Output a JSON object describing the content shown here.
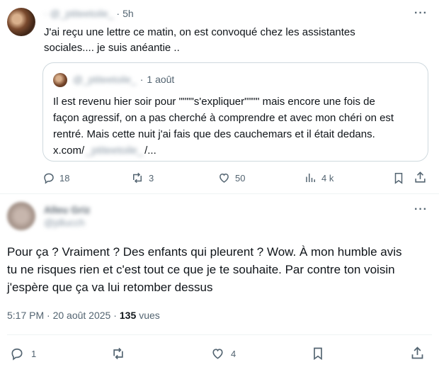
{
  "parent_post": {
    "display_name": "·",
    "handle": "@_ptiteetoile_",
    "separator": "·",
    "time": "5h",
    "text_line1": "J'ai reçu une lettre ce matin, on est convoqué chez les assistantes",
    "text_line2": "sociales.... je suis anéantie ..",
    "quoted": {
      "handle": "@_ptiteetoile_",
      "separator": "·",
      "time": "1 août",
      "line1": "Il est revenu hier soir pour \"\"\"\"s'expliquer\"\"\"\" mais encore une fois de",
      "line2": "façon agressif, on a pas cherché à comprendre et avec mon chéri on est",
      "line3": "rentré. Mais cette nuit j'ai fais que des cauchemars et il était dedans.",
      "link_prefix": "x.com/",
      "link_handle": "_ptiteetoile_",
      "link_suffix": "/..."
    },
    "stats": {
      "replies": "18",
      "reposts": "3",
      "likes": "50",
      "views": "4 k"
    }
  },
  "reply_post": {
    "display_name": "Alleu Griz",
    "handle": "@jdlucch",
    "text_line1": "Pour ça ? Vraiment ? Des enfants qui pleurent ? Wow. À mon humble avis",
    "text_line2": "tu ne risques rien et c'est tout ce que je te souhaite. Par contre ton voisin",
    "text_line3": "j'espère que ça va lui retomber dessus",
    "timestamp": "5:17 PM · 20 août 2025 ·",
    "views_count": "135",
    "views_label": "vues",
    "stats": {
      "replies": "1",
      "likes": "4"
    }
  },
  "icons": {
    "more": "more-icon",
    "reply": "reply-icon",
    "repost": "repost-icon",
    "like": "like-icon",
    "views": "views-icon",
    "bookmark": "bookmark-icon",
    "share": "share-icon"
  },
  "colors": {
    "text": "#0f1419",
    "muted": "#536471",
    "border": "#cfd9de"
  }
}
